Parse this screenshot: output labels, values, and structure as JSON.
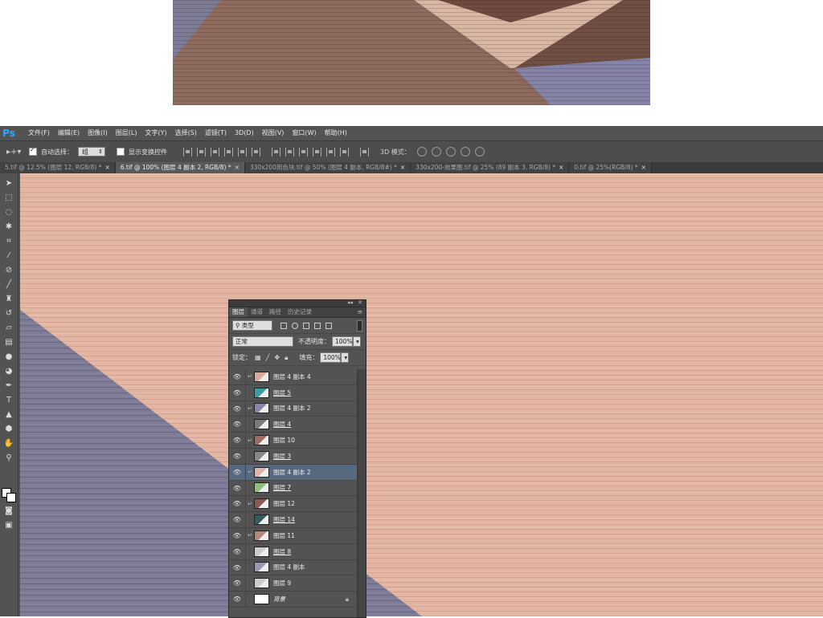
{
  "app": {
    "logo": "Ps"
  },
  "menu": [
    "文件(F)",
    "编辑(E)",
    "图像(I)",
    "图层(L)",
    "文字(Y)",
    "选择(S)",
    "滤镜(T)",
    "3D(D)",
    "视图(V)",
    "窗口(W)",
    "帮助(H)"
  ],
  "options": {
    "auto_select_label": "自动选择：",
    "auto_select_checked": true,
    "auto_select_value": "组",
    "show_transform_label": "显示变换控件",
    "show_transform_checked": false,
    "mode_3d_label": "3D 模式："
  },
  "tabs": [
    {
      "label": "5.tif @ 12.5% (图层 12, RGB/8) *",
      "active": false
    },
    {
      "label": "6.tif @ 100% (图层 4 副本 2, RGB/8) *",
      "active": true
    },
    {
      "label": "330x200用色块.tif @ 50% (图层 4 副本, RGB/8#) *",
      "active": false
    },
    {
      "label": "330x200-效果图.tif @ 25% (89 副本 3, RGB/8) *",
      "active": false
    },
    {
      "label": "0.tif @ 25%(RGB/8) *",
      "active": false
    }
  ],
  "tab_close": "×",
  "layers_panel": {
    "tabs": [
      "图层",
      "通道",
      "路径",
      "历史记录"
    ],
    "active_tab": "图层",
    "filter_kind": "类型",
    "blend_mode": "正常",
    "opacity_label": "不透明度：",
    "opacity_value": "100%",
    "lock_label": "锁定：",
    "fill_label": "填充：",
    "fill_value": "100%",
    "layers": [
      {
        "name": "图层 4 副本 4",
        "clipped": true,
        "thumb": "#d9a89a",
        "selected": false,
        "underline": false
      },
      {
        "name": "图层 5",
        "clipped": false,
        "thumb": "#3a9ea0",
        "selected": false,
        "underline": true
      },
      {
        "name": "图层 4 副本 2",
        "clipped": true,
        "thumb": "#8a86a8",
        "selected": false,
        "underline": false
      },
      {
        "name": "图层 4",
        "clipped": false,
        "thumb": "#7a7a7a",
        "selected": false,
        "underline": true
      },
      {
        "name": "图层 10",
        "clipped": true,
        "thumb": "#9c6e63",
        "selected": false,
        "underline": false
      },
      {
        "name": "图层 3",
        "clipped": false,
        "thumb": "#888888",
        "selected": false,
        "underline": true
      },
      {
        "name": "图层 4 副本 2",
        "clipped": true,
        "thumb": "#e0b4a6",
        "selected": true,
        "underline": false
      },
      {
        "name": "图层 7",
        "clipped": false,
        "thumb": "#8fbf7a",
        "selected": false,
        "underline": true
      },
      {
        "name": "图层 12",
        "clipped": true,
        "thumb": "#8a5a52",
        "selected": false,
        "underline": false
      },
      {
        "name": "图层 14",
        "clipped": false,
        "thumb": "#2f5e5c",
        "selected": false,
        "underline": true
      },
      {
        "name": "图层 11",
        "clipped": true,
        "thumb": "#b38779",
        "selected": false,
        "underline": false
      },
      {
        "name": "图层 8",
        "clipped": false,
        "thumb": "#cccccc",
        "selected": false,
        "underline": true
      },
      {
        "name": "图层 4 副本",
        "clipped": false,
        "thumb": "#9a97b5",
        "selected": false,
        "underline": false
      },
      {
        "name": "图层 9",
        "clipped": false,
        "thumb": "#cccccc",
        "selected": false,
        "underline": false
      },
      {
        "name": "背景",
        "clipped": false,
        "thumb": "#ffffff",
        "selected": false,
        "underline": false,
        "locked": true
      }
    ]
  },
  "colors": {
    "wood_pink": "#e3b6a3",
    "wood_purple": "#7d7b96",
    "wood_brown": "#8b6a5f",
    "selection": "#56697f"
  }
}
